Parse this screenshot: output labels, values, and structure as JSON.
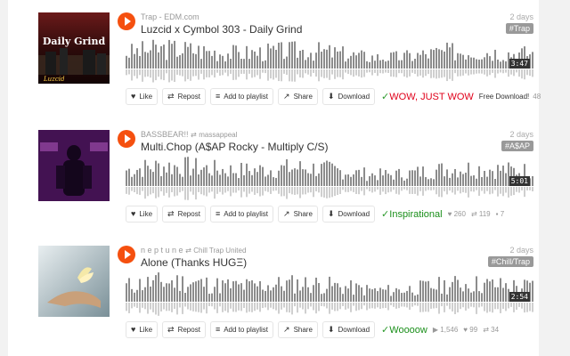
{
  "actions": {
    "like": "Like",
    "repost": "Repost",
    "add_to_playlist": "Add to playlist",
    "share": "Share",
    "download": "Download"
  },
  "tracks": [
    {
      "user": "Trap - EDM.com",
      "reposter": "",
      "title": "Luzcid x Cymbol 303 - Daily Grind",
      "date": "2 days",
      "tag": "#Trap",
      "duration": "3:47",
      "comment": "WOW, JUST WOW",
      "extra": "Free Download!",
      "extra_count": "48",
      "art_text": "Daily Grind",
      "art_badge": "Luzcid"
    },
    {
      "user": "BASSBEAR!!",
      "reposter": "massappeal",
      "title": "Multi.Chop (A$AP Rocky - Multiply C/S)",
      "date": "2 days",
      "tag": "#A$AP",
      "duration": "5:01",
      "comment": "Inspirational",
      "likes": "260",
      "reposts": "119",
      "comments_count": "7"
    },
    {
      "user": "n e p t u n e",
      "reposter": "Chill Trap United",
      "title": "Alone (Thanks HUGΞ)",
      "date": "2 days",
      "tag": "#Chill/Trap",
      "duration": "2:54",
      "comment": "Woooow",
      "plays": "1,546",
      "likes": "99",
      "reposts": "34"
    }
  ],
  "colors": {
    "accent": "#f5500f",
    "wave": "#999999",
    "tag_bg": "#999999"
  }
}
